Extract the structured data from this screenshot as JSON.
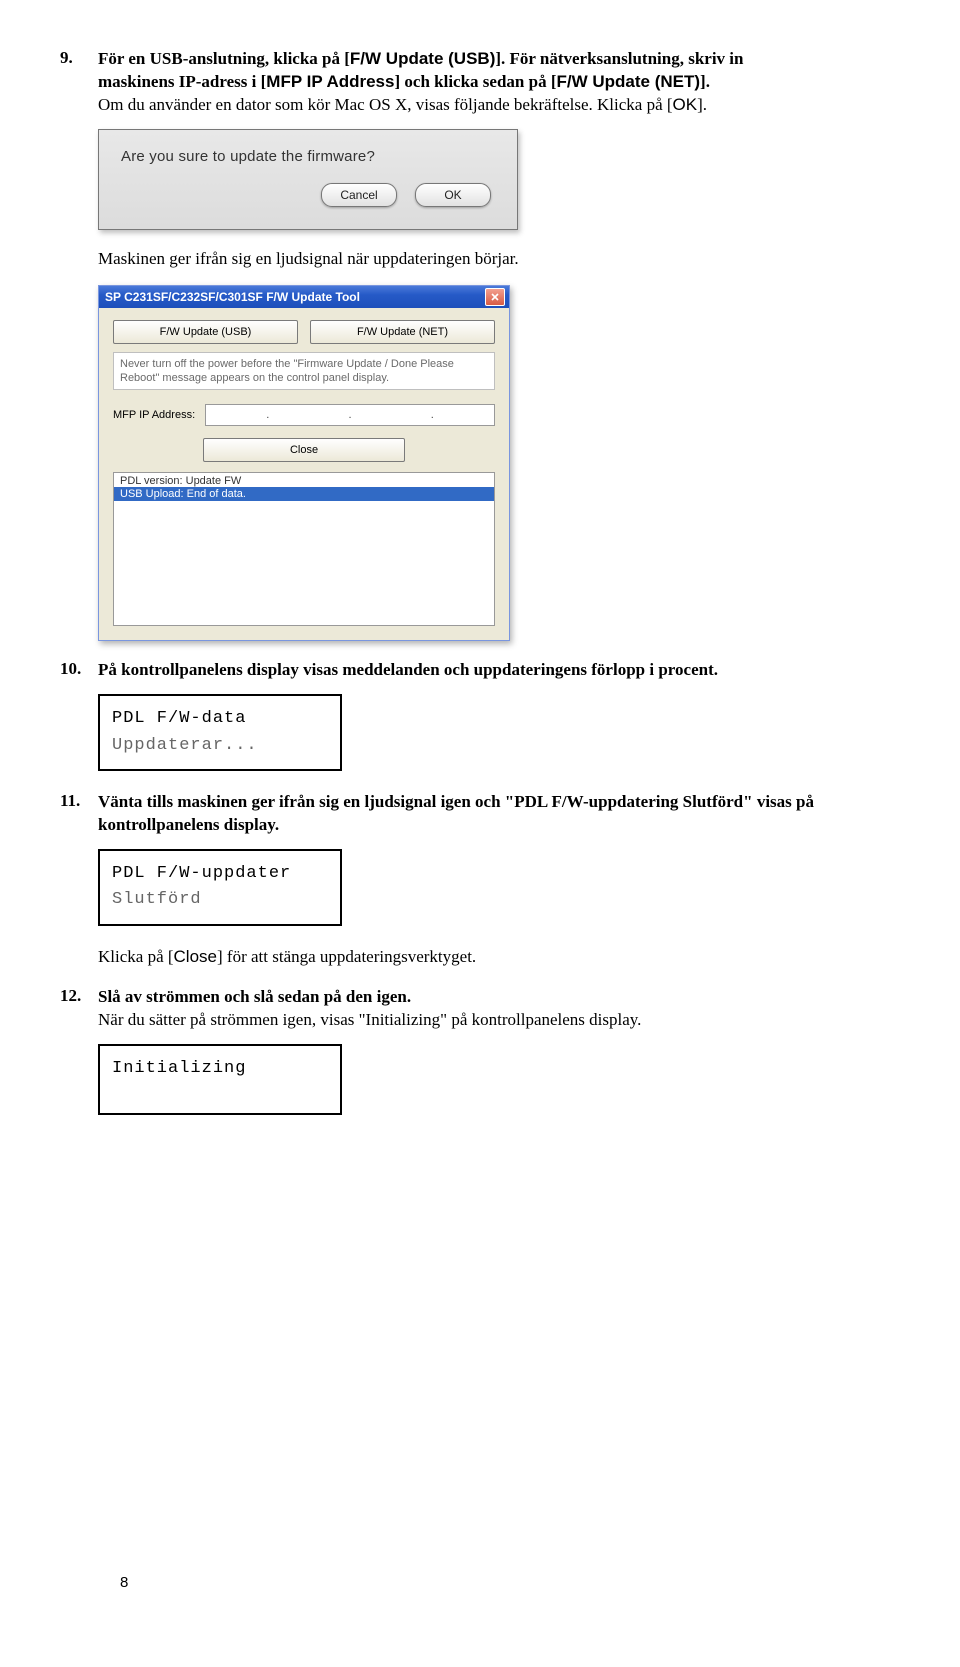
{
  "steps": {
    "s9": {
      "num": "9.",
      "text_pre": "För en USB-anslutning, klicka på [",
      "btn1": "F/W Update (USB)",
      "text_mid1": "]. För nätverksanslutning, skriv in maskinens IP-adress i [",
      "btn2": "MFP IP Address",
      "text_mid2": "] och klicka sedan på [",
      "btn3": "F/W Update (NET)",
      "text_end": "].",
      "line2_pre": "Om du använder en dator som kör Mac OS X, visas följande bekräftelse. Klicka på [",
      "line2_btn": "OK",
      "line2_end": "].",
      "after_dialog": "Maskinen ger ifrån sig en ljudsignal när uppdateringen börjar."
    },
    "mac_dialog": {
      "title": "Are you sure to update the firmware?",
      "cancel": "Cancel",
      "ok": "OK"
    },
    "win_dialog": {
      "title": "SP C231SF/C232SF/C301SF F/W Update Tool",
      "btn_usb": "F/W Update (USB)",
      "btn_net": "F/W Update (NET)",
      "note": "Never turn off the power before the \"Firmware Update / Done Please Reboot\" message appears on the control panel display.",
      "ip_label": "MFP IP Address:",
      "dot": ".",
      "close": "Close",
      "log1": "PDL version: Update FW",
      "log2": "USB Upload: End of data."
    },
    "s10": {
      "num": "10.",
      "text": "På kontrollpanelens display visas meddelanden och uppdateringens förlopp i procent."
    },
    "lcd1": {
      "r1": "PDL F/W-data",
      "r2": "Uppdaterar..."
    },
    "s11": {
      "num": "11.",
      "text": "Vänta tills maskinen ger ifrån sig en ljudsignal igen och \"PDL F/W-uppdatering Slutförd\" visas på kontrollpanelens display."
    },
    "lcd2": {
      "r1": "PDL F/W-uppdater",
      "r2": "Slutförd"
    },
    "s11_sub_pre": "Klicka på [",
    "s11_sub_btn": "Close",
    "s11_sub_end": "] för att stänga uppdateringsverktyget.",
    "s12": {
      "num": "12.",
      "text": "Slå av strömmen och slå sedan på den igen.",
      "line2": "När du sätter på strömmen igen, visas \"Initializing\" på kontrollpanelens display."
    },
    "lcd3": {
      "r1": "Initializing"
    }
  },
  "page_number": "8"
}
